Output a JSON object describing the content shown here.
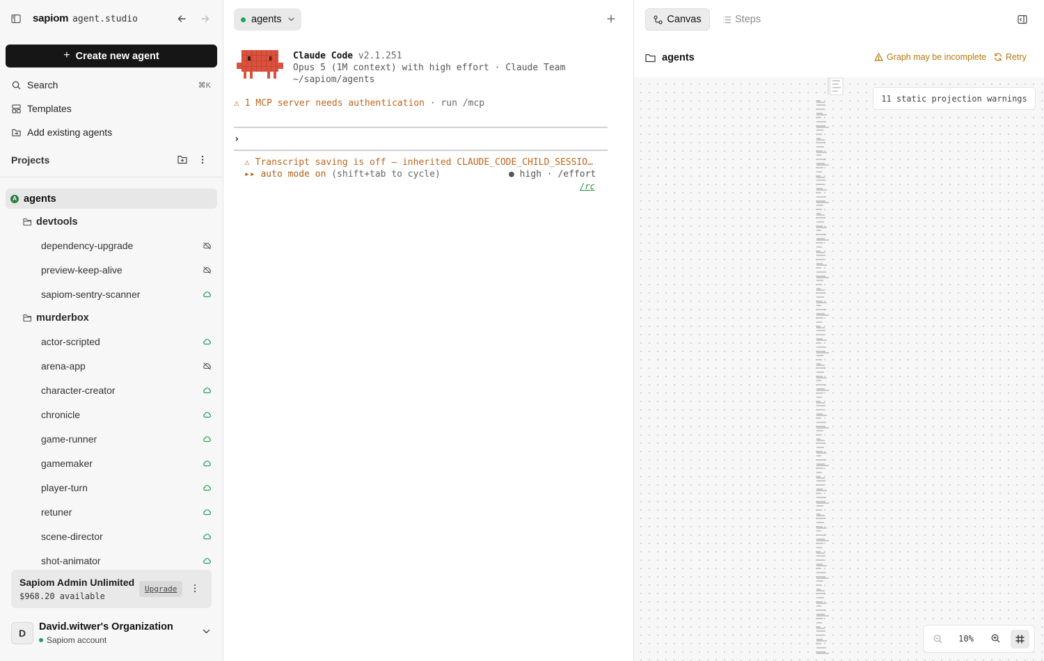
{
  "sidebar": {
    "brand": "sapiom",
    "brand_sub": "agent.studio",
    "create_button": "Create new agent",
    "search_label": "Search",
    "search_shortcut": "⌘K",
    "templates_label": "Templates",
    "add_existing_label": "Add existing agents",
    "projects_label": "Projects",
    "tree": {
      "root": {
        "badge": "A",
        "label": "agents"
      },
      "folders": [
        {
          "label": "devtools",
          "items": [
            {
              "label": "dependency-upgrade",
              "status": "offline"
            },
            {
              "label": "preview-keep-alive",
              "status": "offline"
            },
            {
              "label": "sapiom-sentry-scanner",
              "status": "deployed"
            }
          ]
        },
        {
          "label": "murderbox",
          "items": [
            {
              "label": "actor-scripted",
              "status": "deployed"
            },
            {
              "label": "arena-app",
              "status": "offline"
            },
            {
              "label": "character-creator",
              "status": "deployed"
            },
            {
              "label": "chronicle",
              "status": "deployed"
            },
            {
              "label": "game-runner",
              "status": "deployed"
            },
            {
              "label": "gamemaker",
              "status": "deployed"
            },
            {
              "label": "player-turn",
              "status": "deployed"
            },
            {
              "label": "retuner",
              "status": "deployed"
            },
            {
              "label": "scene-director",
              "status": "deployed"
            },
            {
              "label": "shot-animator",
              "status": "deployed"
            }
          ]
        }
      ]
    },
    "plan": {
      "name": "Sapiom Admin Unlimited",
      "balance": "$968.20 available",
      "upgrade_label": "Upgrade"
    },
    "org": {
      "avatar": "D",
      "name": "David.witwer's Organization",
      "account": "Sapiom account"
    }
  },
  "terminal": {
    "agent_selector": "agents",
    "app_name": "Claude Code",
    "version": "v2.1.251",
    "model_line": "Opus 5 (1M context) with high effort · Claude Team",
    "cwd": "~/sapiom/agents",
    "mcp_warning": "⚠ 1 MCP server needs authentication",
    "mcp_hint": " · run /mcp",
    "prompt_char": "›",
    "transcript_warning": "⚠ Transcript saving is off — inherited CLAUDE_CODE_CHILD_SESSION_ID env var",
    "auto_mode": "▸▸ auto mode on",
    "auto_mode_hint": " (shift+tab to cycle)",
    "effort": "● high · /effort",
    "rc": "/rc"
  },
  "canvas": {
    "tab_canvas": "Canvas",
    "tab_steps": "Steps",
    "folder_label": "agents",
    "graph_warning": "Graph may be incomplete",
    "retry_label": "Retry",
    "projection_warnings": "11 static projection warnings",
    "zoom_level": "10%"
  },
  "colors": {
    "accent_dark": "#161616",
    "online_green": "#21a15a",
    "warning_orange": "#c0631a",
    "warning_amber": "#b77708",
    "mascot_red": "#d9523f"
  },
  "icons": {
    "deployed": "cloud-icon",
    "offline": "cloud-off-icon"
  }
}
